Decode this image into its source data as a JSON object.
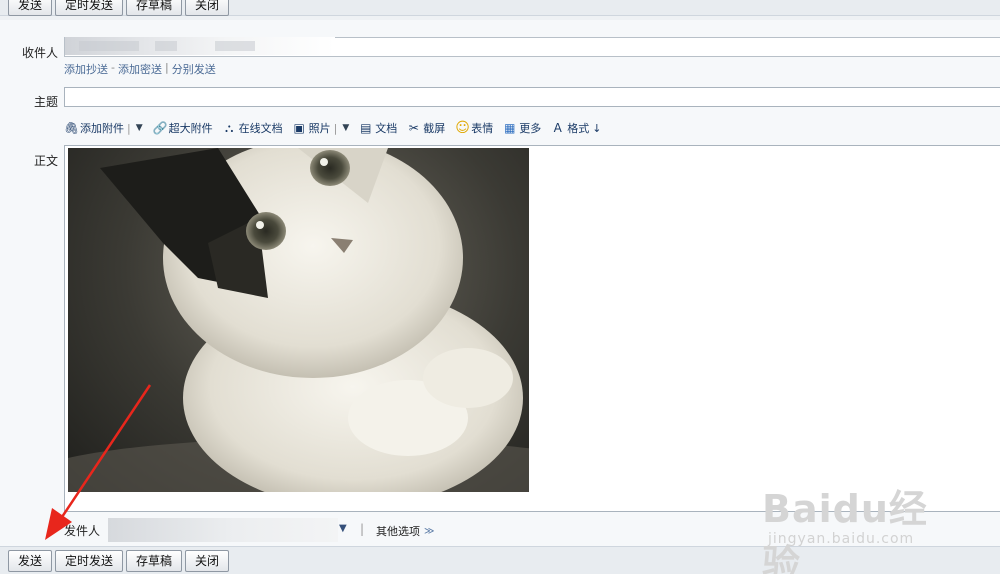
{
  "toolbar": {
    "send": "发送",
    "scheduled_send": "定时发送",
    "save_draft": "存草稿",
    "close": "关闭"
  },
  "form": {
    "to_label": "收件人",
    "to_value": "",
    "links": [
      "添加抄送",
      "-",
      "添加密送",
      "|",
      "分别发送"
    ],
    "subject_label": "主题",
    "subject_value": "",
    "body_label": "正文"
  },
  "format_toolbar": [
    {
      "icon": "paperclip-icon",
      "glyph": "🖇",
      "label": "添加附件",
      "has_caret": true
    },
    {
      "icon": "large-attachment-icon",
      "glyph": "🔗",
      "label": "超大附件",
      "has_caret": false
    },
    {
      "icon": "online-doc-icon",
      "glyph": "⛬",
      "label": "在线文档",
      "has_caret": false
    },
    {
      "icon": "photo-icon",
      "glyph": "▣",
      "label": "照片",
      "has_caret": true
    },
    {
      "icon": "document-icon",
      "glyph": "▤",
      "label": "文档",
      "has_caret": false
    },
    {
      "icon": "screenshot-icon",
      "glyph": "✂",
      "label": "截屏",
      "has_caret": false
    },
    {
      "icon": "emoji-icon",
      "glyph": "☺",
      "label": "表情",
      "has_caret": false
    },
    {
      "icon": "more-icon",
      "glyph": "▦",
      "label": "更多",
      "has_caret": false
    },
    {
      "icon": "format-icon",
      "glyph": "A",
      "label": "格式",
      "has_caret": false,
      "suffix": "↓"
    }
  ],
  "sender": {
    "label": "发件人",
    "value": "",
    "more_options": "其他选项"
  },
  "watermark": {
    "brand": "Baidu经验",
    "url": "jingyan.baidu.com"
  },
  "colors": {
    "link": "#4a6a95",
    "toolbar_text": "#1a3a66",
    "arrow": "#e8261c"
  }
}
